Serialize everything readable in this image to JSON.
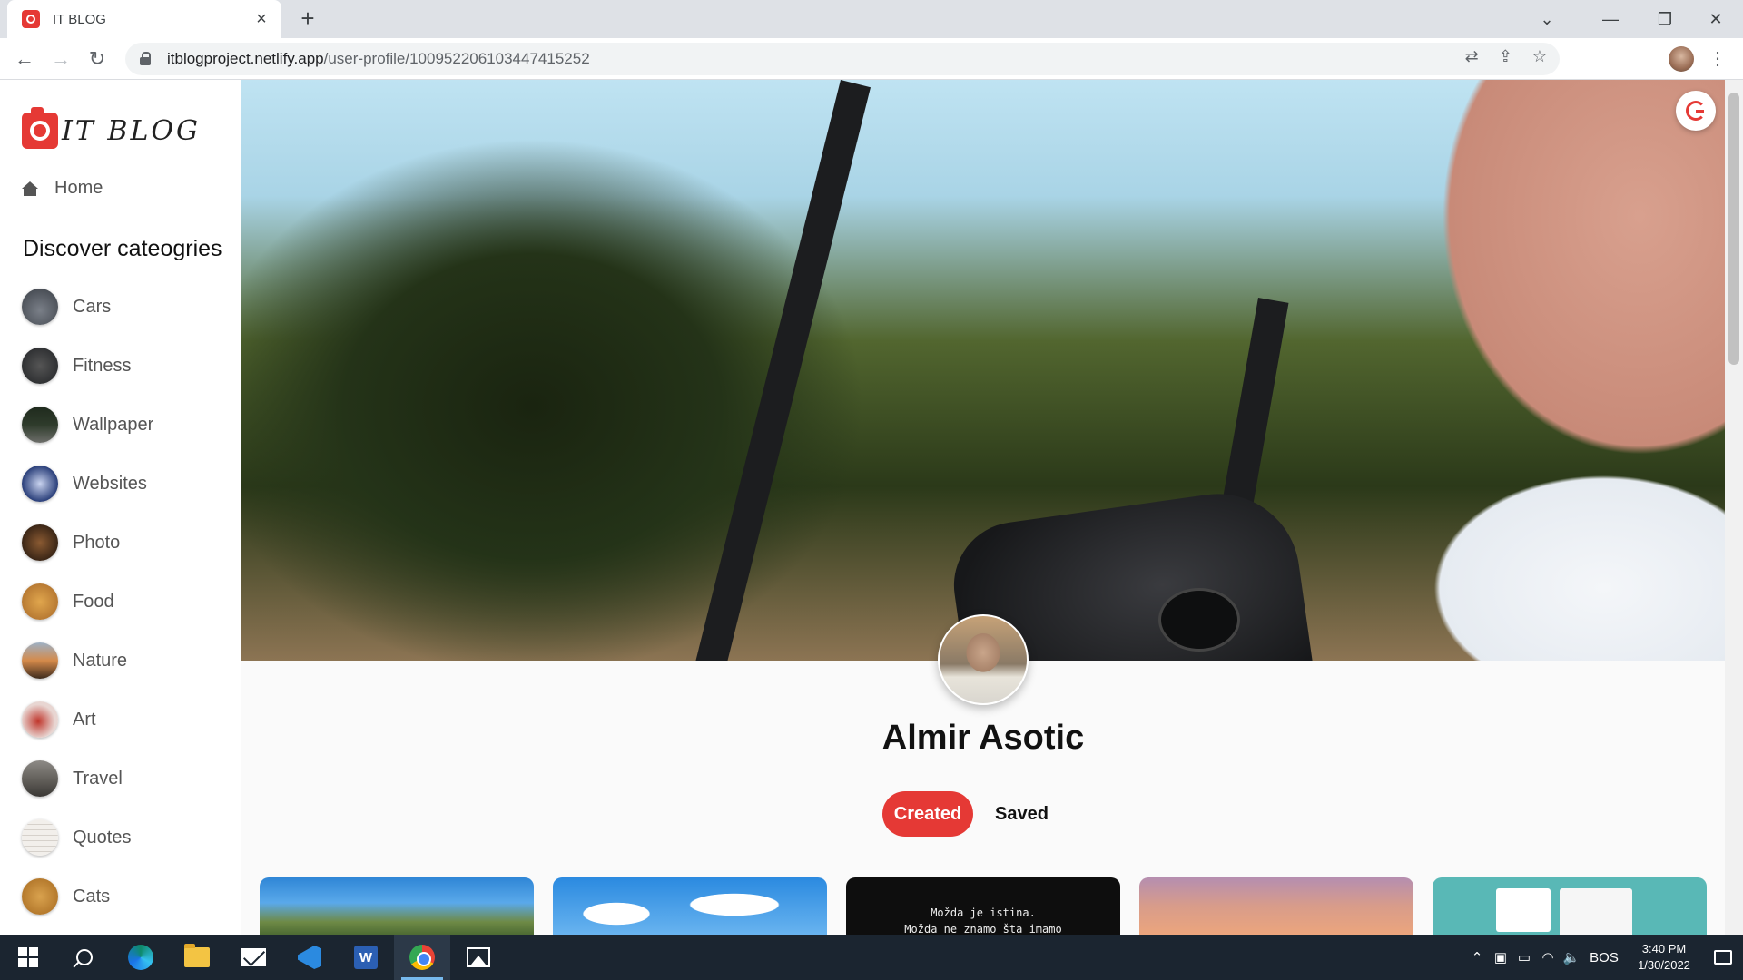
{
  "browser": {
    "tab_title": "IT BLOG",
    "url_domain": "itblogproject.netlify.app",
    "url_path": "/user-profile/100952206103447415252"
  },
  "sidebar": {
    "logo_text": "IT BLOG",
    "home_label": "Home",
    "discover_heading": "Discover cateogries",
    "categories": [
      {
        "label": "Cars",
        "color": "#3a3f46"
      },
      {
        "label": "Fitness",
        "color": "#202225"
      },
      {
        "label": "Wallpaper",
        "color": "#2e3b2b"
      },
      {
        "label": "Websites",
        "color": "#2a3f7a"
      },
      {
        "label": "Photo",
        "color": "#3b2616"
      },
      {
        "label": "Food",
        "color": "#b87a33"
      },
      {
        "label": "Nature",
        "color": "#8a5b3a"
      },
      {
        "label": "Art",
        "color": "#e8d6d2"
      },
      {
        "label": "Travel",
        "color": "#5d5a55"
      },
      {
        "label": "Quotes",
        "color": "#e9e6e2"
      },
      {
        "label": "Cats",
        "color": "#b57a2d"
      }
    ]
  },
  "profile": {
    "name": "Almir Asotic",
    "tab_created": "Created",
    "tab_saved": "Saved",
    "accent": "#e53935"
  },
  "posts": {
    "quote_line1": "Možda je istina.",
    "quote_line2": "Možda ne znamo šta imamo"
  },
  "taskbar": {
    "language": "BOS",
    "time": "3:40 PM",
    "date": "1/30/2022"
  }
}
